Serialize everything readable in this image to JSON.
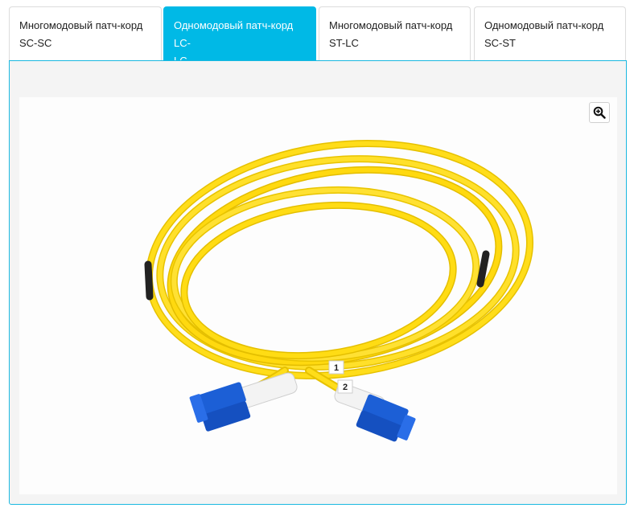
{
  "tabs": [
    {
      "label": "Многомодовый патч-корд\nSC-SC",
      "active": false
    },
    {
      "label": "Одномодовый патч-корд LC-\nLC",
      "active": true
    },
    {
      "label": "Многомодовый патч-корд\nST-LC",
      "active": false
    },
    {
      "label": "Одномодовый патч-корд\nSC-ST",
      "active": false
    }
  ],
  "colors": {
    "active_tab": "#00b9e6",
    "cable": "#ffd800",
    "connector": "#1c5fd6"
  },
  "image": {
    "zoom_icon": "zoom-in-icon",
    "cable_labels": [
      "1",
      "2"
    ]
  }
}
